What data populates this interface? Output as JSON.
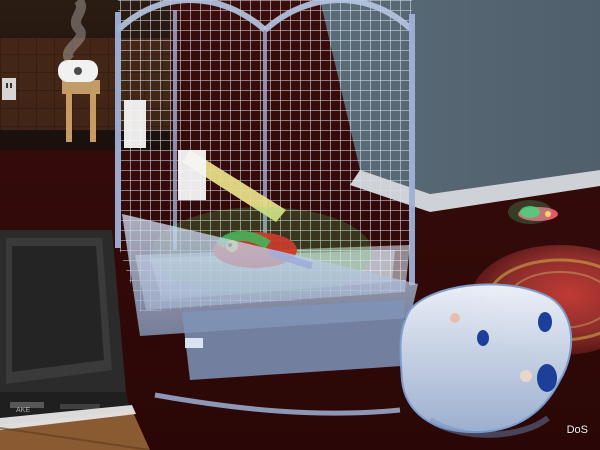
{
  "scene": {
    "description_style": "screenshot",
    "watermark": "DoS",
    "objects": {
      "cage": "bird-cage",
      "bird": "parrot",
      "tv": "crt-television",
      "table": "side-table",
      "humidifier": "humidifier",
      "pet_bed": "pet-bed",
      "rug": "oriental-rug",
      "floor": "carpet-floor",
      "wall": "blue-gray-wall",
      "toy": "glowing-toy"
    },
    "colors": {
      "wall": "#5f6f7c",
      "carpet": "#4a1412",
      "cage": "#a9b9d8",
      "tray": "#c9d7ef",
      "stand": "#7f94b8",
      "bird_body": "#c83c2a",
      "bird_green": "#41b45a",
      "tv": "#2b2b2b",
      "bed": "#dfe8f5",
      "wood": "#6a3c1f",
      "rug": "#8b2d2a",
      "toy": "#4bd27f"
    }
  }
}
